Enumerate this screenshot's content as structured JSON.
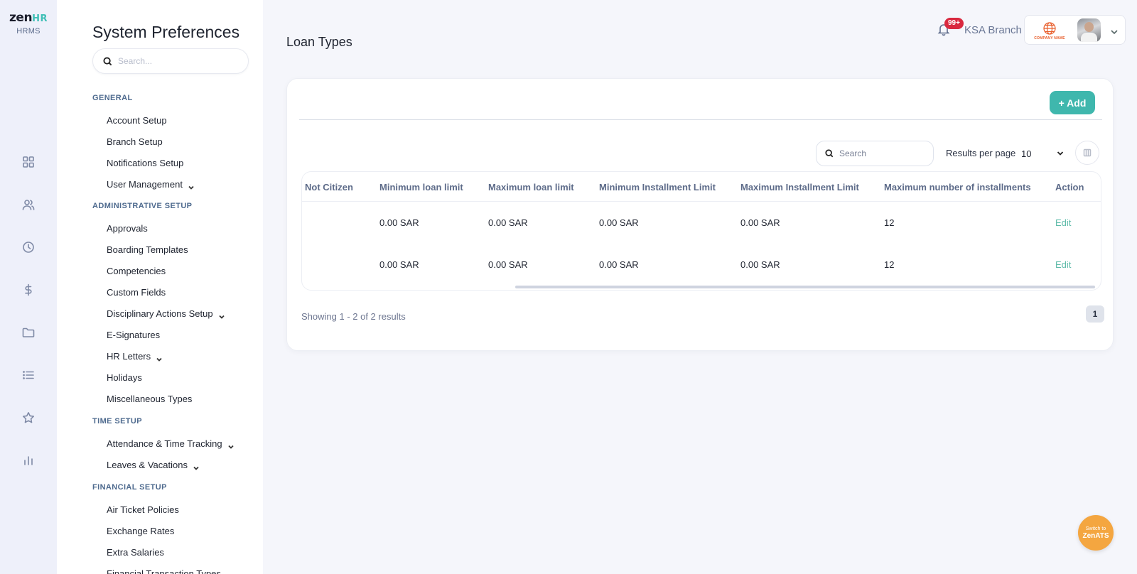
{
  "brand": {
    "logo_zen": "zen",
    "logo_hr": "HR",
    "logo_sub": "HRMS"
  },
  "rail": {
    "icons": [
      "dashboard-icon",
      "people-icon",
      "clock-icon",
      "dollar-icon",
      "folder-icon",
      "list-icon",
      "star-icon",
      "bar-chart-icon"
    ]
  },
  "sidebar": {
    "title": "System Preferences",
    "search_placeholder": "Search...",
    "sections": {
      "general": "GENERAL",
      "admin": "ADMINISTRATIVE SETUP",
      "time": "TIME SETUP",
      "financial": "FINANCIAL SETUP"
    },
    "items": {
      "account_setup": "Account Setup",
      "branch_setup": "Branch Setup",
      "notifications_setup": "Notifications Setup",
      "user_management": "User Management",
      "approvals": "Approvals",
      "boarding_templates": "Boarding Templates",
      "competencies": "Competencies",
      "custom_fields": "Custom Fields",
      "disciplinary_actions_setup": "Disciplinary Actions Setup",
      "e_signatures": "E-Signatures",
      "hr_letters": "HR Letters",
      "holidays": "Holidays",
      "miscellaneous_types": "Miscellaneous Types",
      "attendance_time_tracking": "Attendance & Time Tracking",
      "leaves_vacations": "Leaves & Vacations",
      "air_ticket_policies": "Air Ticket Policies",
      "exchange_rates": "Exchange Rates",
      "extra_salaries": "Extra Salaries",
      "financial_transaction_types": "Financial Transaction Types"
    }
  },
  "header": {
    "page_title": "Loan Types",
    "notification_count": "99+",
    "branch": "KSA Branch",
    "company_logo_text": "COMPANY NAME"
  },
  "toolbar": {
    "add_label": "+ Add",
    "search_placeholder": "Search",
    "results_per_page_label": "Results per page",
    "results_per_page_value": "10"
  },
  "table": {
    "columns": [
      "Not Citizen",
      "Minimum loan limit",
      "Maximum loan limit",
      "Minimum Installment Limit",
      "Maximum Installment Limit",
      "Maximum number of installments",
      "Action"
    ],
    "rows": [
      [
        "",
        "0.00 SAR",
        "0.00 SAR",
        "0.00 SAR",
        "0.00 SAR",
        "12",
        "Edit"
      ],
      [
        "",
        "0.00 SAR",
        "0.00 SAR",
        "0.00 SAR",
        "0.00 SAR",
        "12",
        "Edit"
      ]
    ]
  },
  "pagination": {
    "showing": "Showing 1 - 2 of 2 results",
    "current_page": "1"
  },
  "zenats": {
    "line1": "Switch to",
    "line2": "ZenATS"
  },
  "colors": {
    "accent": "#3fb7ad",
    "badge": "#d9293f",
    "zenats": "#f4a640",
    "edit_link": "#5ebba9"
  }
}
